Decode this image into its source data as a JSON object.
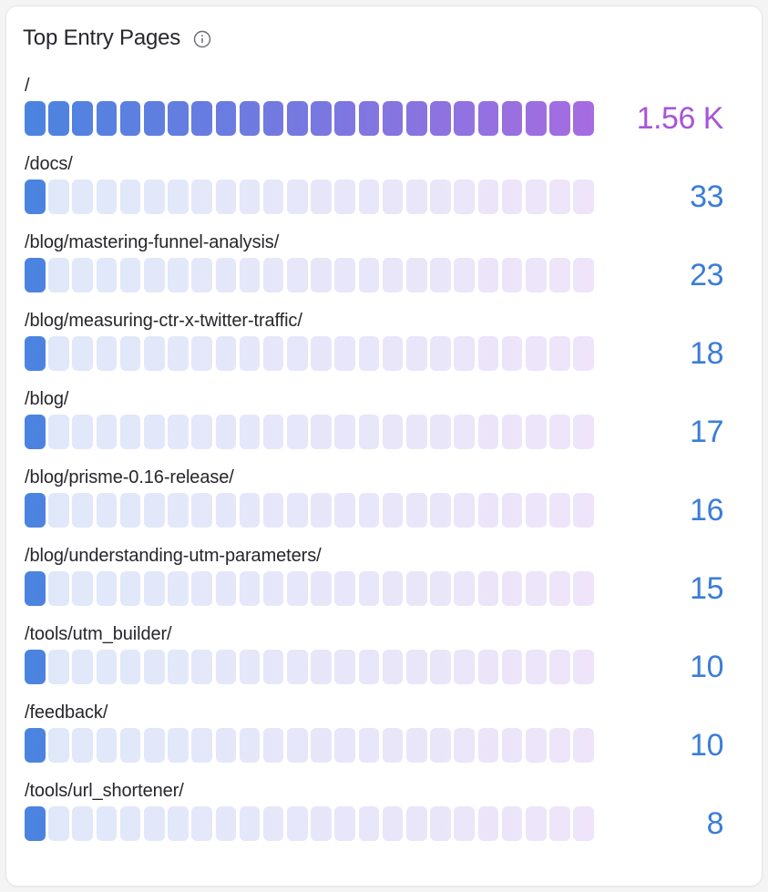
{
  "panel": {
    "title": "Top Entry Pages",
    "info_icon": "info-circle-icon"
  },
  "colors": {
    "gradient_start": "#4a84e0",
    "gradient_end": "#a66ce0",
    "value_blue": "#3b7dd8",
    "value_purple": "#a855d8",
    "card_background": "#ffffff",
    "page_background": "#f4f4f5",
    "card_border": "#e6e6e9",
    "label_text": "#26262b",
    "title_text": "#27272d",
    "icon_stroke": "#6b6b72"
  },
  "chart_data": {
    "type": "bar",
    "title": "Top Entry Pages",
    "xlabel": "",
    "ylabel": "",
    "orientation": "horizontal",
    "segments_per_bar": 24,
    "max_value": 1560,
    "categories": [
      "/",
      "/docs/",
      "/blog/mastering-funnel-analysis/",
      "/blog/measuring-ctr-x-twitter-traffic/",
      "/blog/",
      "/blog/prisme-0.16-release/",
      "/blog/understanding-utm-parameters/",
      "/tools/utm_builder/",
      "/feedback/",
      "/tools/url_shortener/"
    ],
    "values": [
      1560,
      33,
      23,
      18,
      17,
      16,
      15,
      10,
      10,
      8
    ],
    "value_labels": [
      "1.56 K",
      "33",
      "23",
      "18",
      "17",
      "16",
      "15",
      "10",
      "10",
      "8"
    ]
  },
  "rows": [
    {
      "label": "/",
      "value_label": "1.56 K",
      "value": 1560,
      "fill_ratio": 1.0,
      "value_color": "#a855d8"
    },
    {
      "label": "/docs/",
      "value_label": "33",
      "value": 33,
      "fill_ratio": 0.0212,
      "value_color": "#3b7dd8"
    },
    {
      "label": "/blog/mastering-funnel-analysis/",
      "value_label": "23",
      "value": 23,
      "fill_ratio": 0.0147,
      "value_color": "#3b7dd8"
    },
    {
      "label": "/blog/measuring-ctr-x-twitter-traffic/",
      "value_label": "18",
      "value": 18,
      "fill_ratio": 0.0115,
      "value_color": "#3b7dd8"
    },
    {
      "label": "/blog/",
      "value_label": "17",
      "value": 17,
      "fill_ratio": 0.0109,
      "value_color": "#3b7dd8"
    },
    {
      "label": "/blog/prisme-0.16-release/",
      "value_label": "16",
      "value": 16,
      "fill_ratio": 0.0103,
      "value_color": "#3b7dd8"
    },
    {
      "label": "/blog/understanding-utm-parameters/",
      "value_label": "15",
      "value": 15,
      "fill_ratio": 0.0096,
      "value_color": "#3b7dd8"
    },
    {
      "label": "/tools/utm_builder/",
      "value_label": "10",
      "value": 10,
      "fill_ratio": 0.0064,
      "value_color": "#3b7dd8"
    },
    {
      "label": "/feedback/",
      "value_label": "10",
      "value": 10,
      "fill_ratio": 0.0064,
      "value_color": "#3b7dd8"
    },
    {
      "label": "/tools/url_shortener/",
      "value_label": "8",
      "value": 8,
      "fill_ratio": 0.0051,
      "value_color": "#3b7dd8"
    }
  ]
}
